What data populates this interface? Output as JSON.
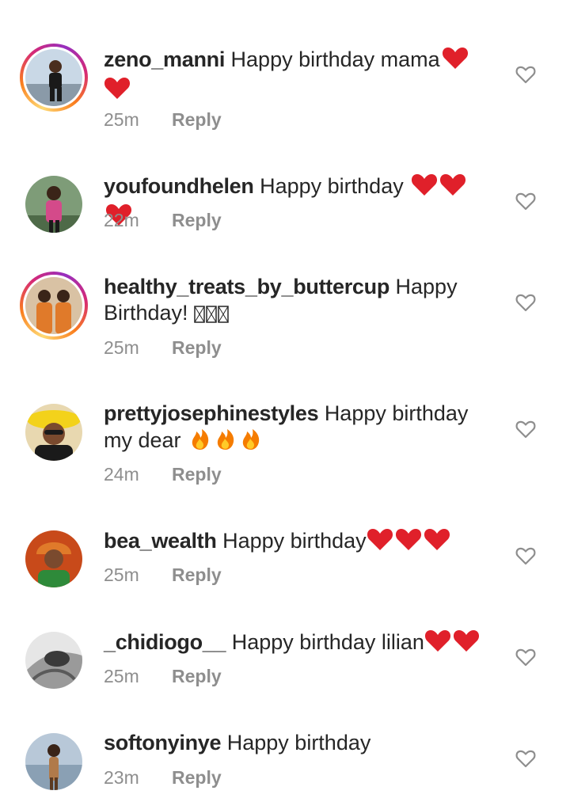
{
  "comments": [
    {
      "username": "zeno_manni",
      "text": "Happy birthday mama",
      "emoji": [
        "heart",
        "heart"
      ],
      "time": "25m",
      "reply": "Reply",
      "story_ring": true,
      "avatar_colors": [
        "#7aa6c9",
        "#1a1a1a"
      ]
    },
    {
      "username": "youfoundhelen",
      "text": "Happy birthday ",
      "emoji": [
        "heart",
        "heart",
        "heart"
      ],
      "time": "22m",
      "reply": "Reply",
      "story_ring": false,
      "avatar_colors": [
        "#6f8f6a",
        "#d44a8a"
      ]
    },
    {
      "username": "healthy_treats_by_buttercup",
      "text": "Happy Birthday! ",
      "emoji": [
        "box",
        "box",
        "box"
      ],
      "time": "25m",
      "reply": "Reply",
      "story_ring": true,
      "avatar_colors": [
        "#c9a27a",
        "#e07a2a"
      ]
    },
    {
      "username": "prettyjosephinestyles",
      "text": "Happy birthday my dear ",
      "emoji": [
        "fire",
        "fire",
        "fire"
      ],
      "time": "24m",
      "reply": "Reply",
      "story_ring": false,
      "avatar_colors": [
        "#f3d21b",
        "#1a1a1a"
      ]
    },
    {
      "username": "bea_wealth",
      "text": "Happy birthday",
      "emoji": [
        "heart",
        "heart",
        "heart"
      ],
      "time": "25m",
      "reply": "Reply",
      "story_ring": false,
      "avatar_colors": [
        "#c84a1a",
        "#2e8a3a"
      ]
    },
    {
      "username": "_chidiogo__",
      "text": "Happy birthday lilian",
      "emoji": [
        "heart",
        "heart"
      ],
      "time": "25m",
      "reply": "Reply",
      "story_ring": false,
      "avatar_colors": [
        "#d8d8d8",
        "#3a3a3a"
      ]
    },
    {
      "username": "softonyinye",
      "text": "Happy birthday",
      "emoji": [],
      "time": "23m",
      "reply": "Reply",
      "story_ring": false,
      "avatar_colors": [
        "#a7b8c8",
        "#b07a4a"
      ]
    }
  ],
  "colors": {
    "text": "#262626",
    "meta": "#8e8e8e",
    "heart": "#e0202a",
    "like_outline": "#8e8e8e"
  },
  "icons": {
    "like": "heart-outline-icon",
    "heart": "red-heart-emoji",
    "fire": "fire-emoji",
    "box": "missing-glyph-box"
  }
}
